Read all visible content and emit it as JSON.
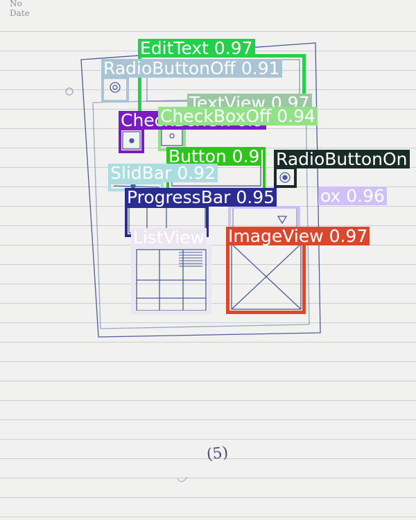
{
  "paper": {
    "header_no": "No",
    "header_date": "Date",
    "page_mark": "(5)"
  },
  "detections": [
    {
      "class": "EditText",
      "score": "0.97",
      "label": "EditText 0.97",
      "color": "#22d04a",
      "text_color": "#ffffff"
    },
    {
      "class": "RadioButtonOff",
      "score": "0.91",
      "label": "RadioButtonOff 0.91",
      "color": "#a9c4d4",
      "text_color": "#ffffff"
    },
    {
      "class": "TextView",
      "score": "0.97",
      "label": "TextView 0.97",
      "color": "#9bc7a2",
      "text_color": "#ffffff"
    },
    {
      "class": "CheckBoxOn",
      "score": "0.9",
      "label": "CheckBoxOn 0.9",
      "color": "#7a1bc3",
      "text_color": "#ffffff"
    },
    {
      "class": "CheckBoxOff",
      "score": "0.94",
      "label": "CheckBoxOff 0.94",
      "color": "#93e28a",
      "text_color": "#ffffff"
    },
    {
      "class": "Button",
      "score": "0.9",
      "label": "Button 0.9",
      "color": "#2fc41b",
      "text_color": "#ffffff"
    },
    {
      "class": "RadioButtonOn",
      "score": "",
      "label": "RadioButtonOn",
      "color": "#1a2c28",
      "text_color": "#ffffff"
    },
    {
      "class": "SlidBar",
      "score": "0.92",
      "label": "SlidBar 0.92",
      "color": "#a9dde0",
      "text_color": "#ffffff"
    },
    {
      "class": "ProgressBar",
      "score": "0.95",
      "label": "ProgressBar 0.95",
      "color": "#2a2c91",
      "text_color": "#ffffff"
    },
    {
      "class": "CheckBox",
      "score": "0.96",
      "label": "ox 0.96",
      "color": "#cfc0f6",
      "text_color": "#ffffff"
    },
    {
      "class": "ListView",
      "score": "",
      "label": "ListView",
      "color": "#ece6f1",
      "text_color": "#ffffff"
    },
    {
      "class": "ImageView",
      "score": "0.97",
      "label": "ImageView 0.97",
      "color": "#d9472c",
      "text_color": "#ffffff"
    }
  ]
}
